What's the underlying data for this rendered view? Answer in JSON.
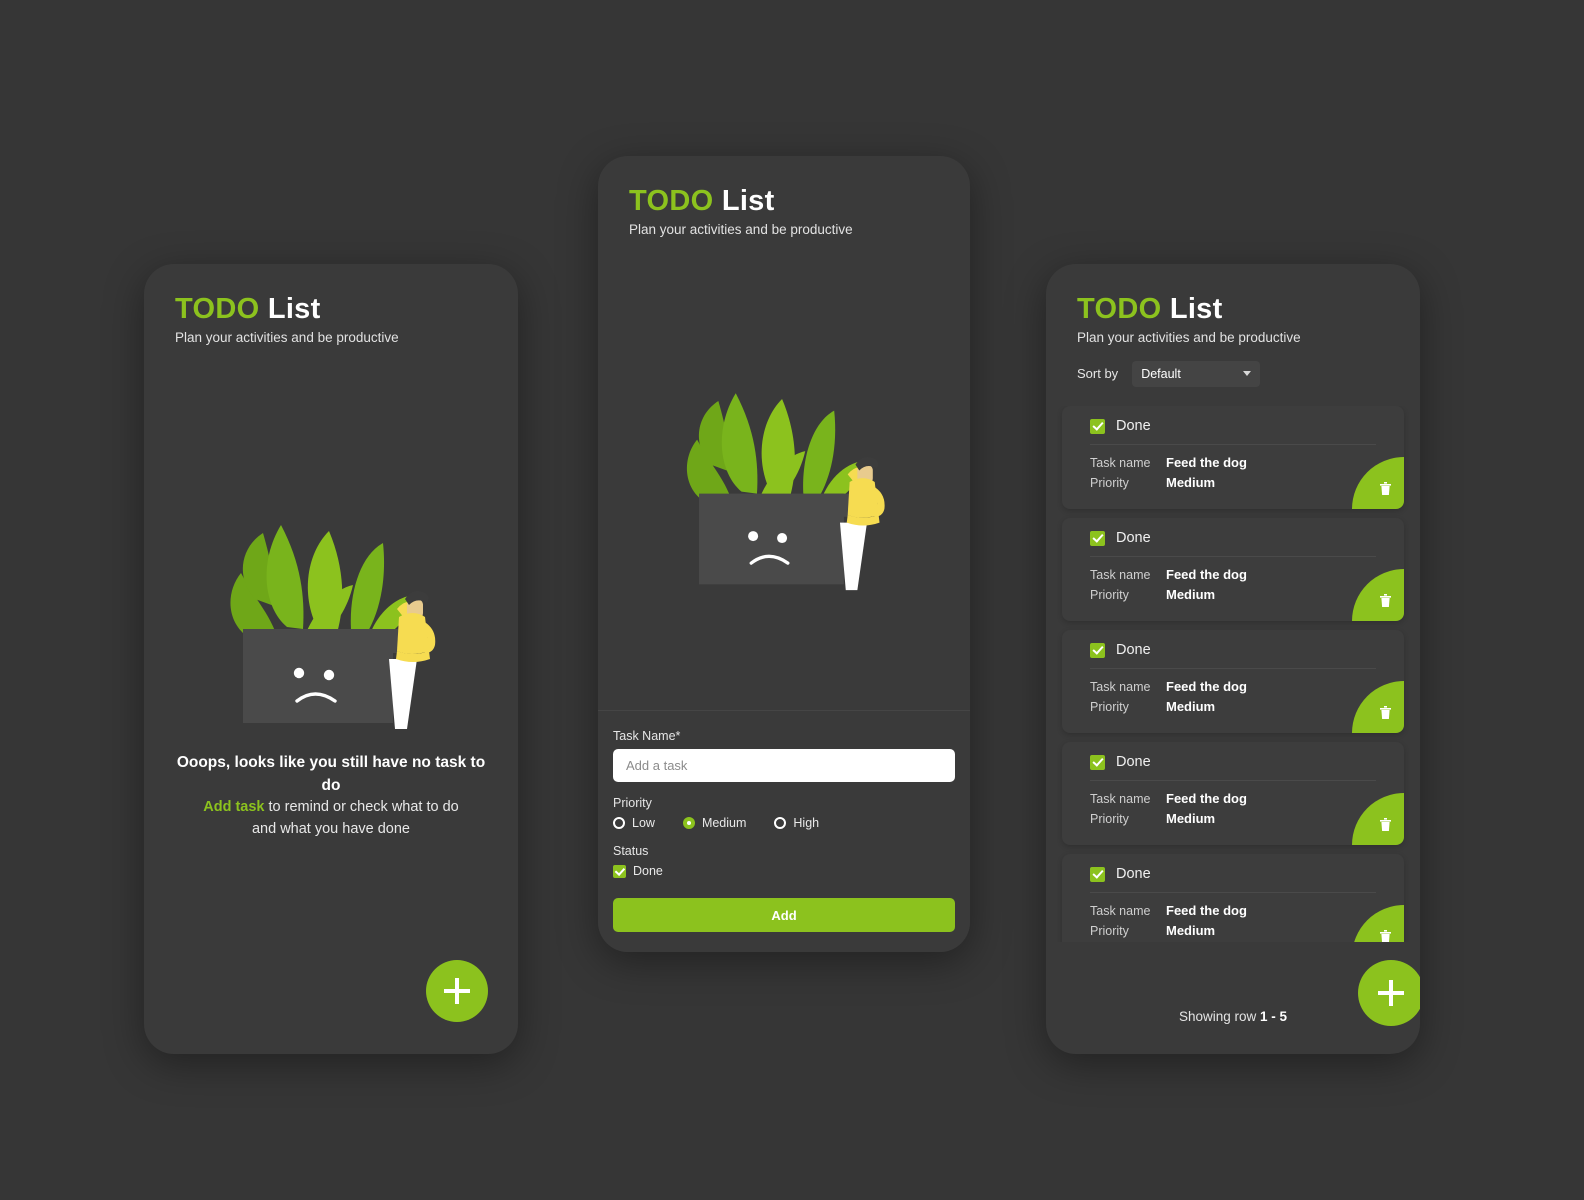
{
  "app": {
    "title_primary": "TODO",
    "title_secondary": "List",
    "subtitle": "Plan your activities and be productive",
    "accent_color": "#8CC21E",
    "background_color": "#363636",
    "card_color": "#3d3d3d"
  },
  "empty_screen": {
    "headline": "Ooops, looks like you still have no task to do",
    "cta_text": "Add task",
    "cta_rest": " to remind or check what to do",
    "line3": "and what you have done",
    "fab_label": "+",
    "illustration": "empty-folder-sad-face-illustration"
  },
  "form_screen": {
    "task_name_label": "Task Name*",
    "task_input_value": "",
    "task_input_placeholder": "Add a task",
    "priority_label": "Priority",
    "priority_options": [
      {
        "label": "Low",
        "selected": false
      },
      {
        "label": "Medium",
        "selected": true
      },
      {
        "label": "High",
        "selected": false
      }
    ],
    "status_label": "Status",
    "status_checkbox_label": "Done",
    "status_checked": true,
    "submit_label": "Add",
    "illustration": "empty-folder-sad-face-illustration"
  },
  "list_screen": {
    "sort_label": "Sort by",
    "sort_value": "Default",
    "sort_options": [
      "Default"
    ],
    "row_key_task": "Task name",
    "row_key_priority": "Priority",
    "done_label": "Done",
    "tasks": [
      {
        "done": true,
        "task_name": "Feed the dog",
        "priority": "Medium"
      },
      {
        "done": true,
        "task_name": "Feed the dog",
        "priority": "Medium"
      },
      {
        "done": true,
        "task_name": "Feed the dog",
        "priority": "Medium"
      },
      {
        "done": true,
        "task_name": "Feed the dog",
        "priority": "Medium"
      },
      {
        "done": true,
        "task_name": "Feed the dog",
        "priority": "Medium"
      }
    ],
    "showing_prefix": "Showing row ",
    "showing_range": "1 - 5",
    "fab_label": "+"
  }
}
